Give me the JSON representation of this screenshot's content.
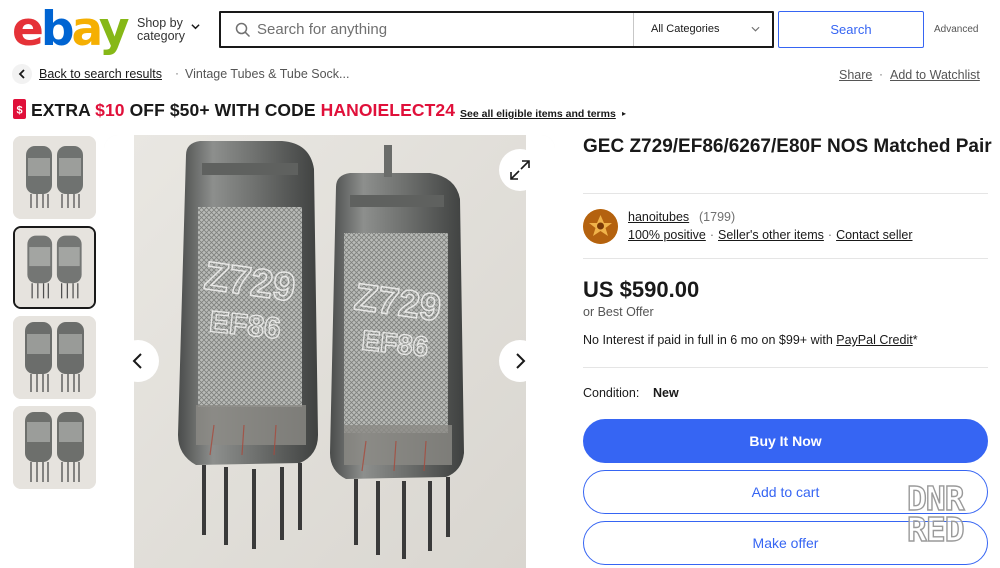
{
  "header": {
    "logo": [
      "e",
      "b",
      "a",
      "y"
    ],
    "shop_by_line1": "Shop by",
    "shop_by_line2": "category",
    "search_placeholder": "Search for anything",
    "category_select": "All Categories",
    "search_button": "Search",
    "advanced_link": "Advanced"
  },
  "breadcrumb": {
    "back_label": "Back to search results",
    "separator": "·",
    "category": "Vintage Tubes & Tube Sock...",
    "share": "Share",
    "share_separator": "·",
    "watchlist": "Add to Watchlist"
  },
  "promo": {
    "text_1": "EXTRA ",
    "amount": "$10",
    "text_2": " OFF $50+ WITH CODE ",
    "code": "HANOIELECT24",
    "link": "See all eligible items and terms",
    "link_arrow": "▸",
    "color_red": "#e0103a"
  },
  "gallery": {
    "thumbnail_count": 4,
    "selected_index": 1,
    "tube_print_1": "Z729",
    "tube_print_2": "EF86"
  },
  "item": {
    "title": "GEC Z729/EF86/6267/E80F NOS Matched Pair",
    "seller": {
      "name": "hanoitubes",
      "count": "(1799)",
      "positive": "100% positive",
      "other_items": "Seller's other items",
      "contact": "Contact seller",
      "separator": "·"
    },
    "price": "US $590.00",
    "best_offer": "or Best Offer",
    "credit_text": "No Interest if paid in full in 6 mo on $99+ with ",
    "credit_link": "PayPal Credit",
    "credit_star": "*",
    "condition_label": "Condition:",
    "condition_value": "New"
  },
  "actions": {
    "buy_now": "Buy It Now",
    "add_to_cart": "Add to cart",
    "make_offer": "Make offer",
    "accent": "#3665f3"
  },
  "watermark": {
    "line1": "DNR",
    "line2": "RED"
  }
}
